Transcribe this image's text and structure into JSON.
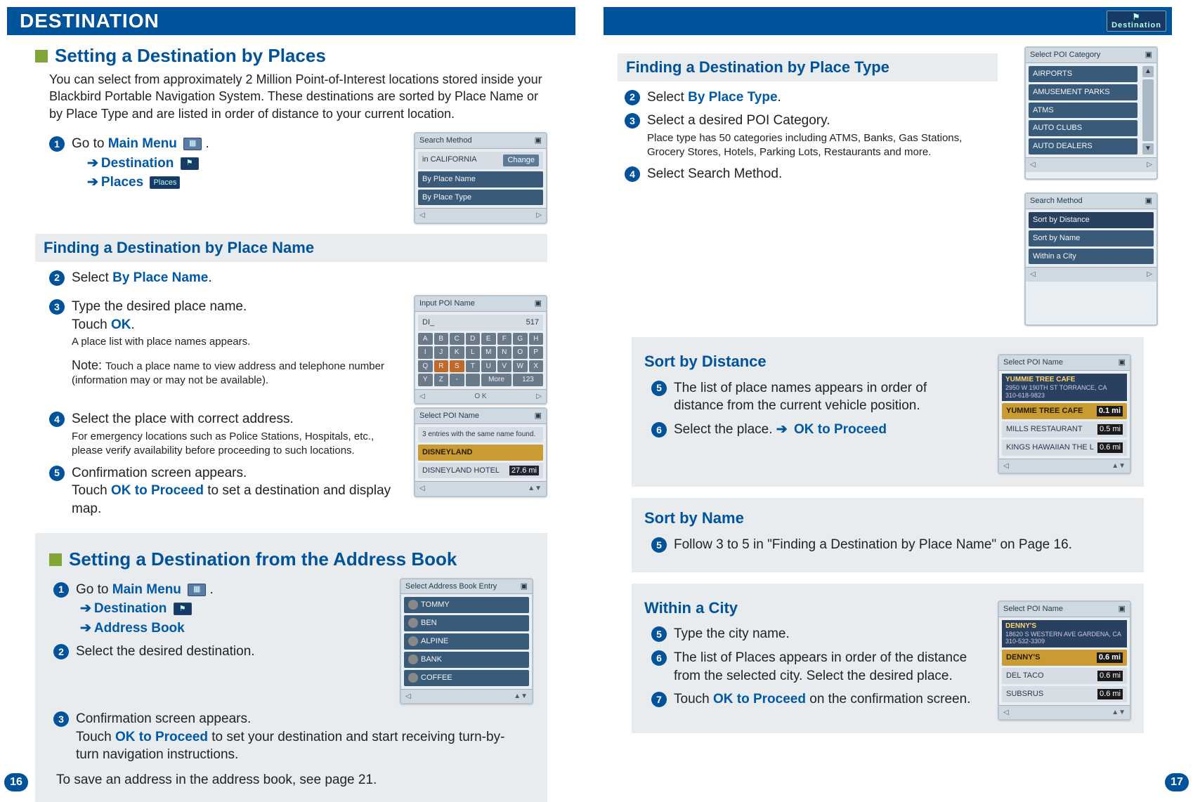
{
  "left": {
    "header": "DESTINATION",
    "section1_title": "Setting a Destination by Places",
    "intro": "You can select from approximately 2 Million Point-of-Interest locations stored inside your Blackbird Portable Navigation System.  These destinations are sorted by Place Name or by Place Type and are listed in order of distance to your current location.",
    "step1_pre": "Go to ",
    "step1_link": "Main Menu",
    "step1_post": " .",
    "step1_a_label": "Destination",
    "step1_b_label": "Places",
    "sub_name": "Finding a Destination by Place Name",
    "step2_pre": "Select ",
    "step2_link": "By Place Name",
    "step2_post": ".",
    "step3_l1": "Type the desired place name.",
    "step3_l2a": "Touch ",
    "step3_l2b": "OK",
    "step3_l2c": ".",
    "step3_sub": "A place list with place names appears.",
    "step3_note_lbl": "Note: ",
    "step3_note": "Touch a place name to view address and telephone number (information may or may not be available).",
    "step4_l1": "Select the place with correct address.",
    "step4_sub": "For emergency locations such as Police Stations, Hospitals, etc., please verify availability before proceeding to such locations.",
    "step5_l1": "Confirmation screen appears.",
    "step5_l2a": "Touch ",
    "step5_l2b": "OK to Proceed",
    "step5_l2c": " to set a destination and display map.",
    "section2_title": "Setting a Destination from the Address Book",
    "ab_step1_pre": "Go to ",
    "ab_step1_link": "Main Menu",
    "ab_step1_post": " .",
    "ab_step1_a": "Destination",
    "ab_step1_b": "Address Book",
    "ab_step2": "Select the desired destination.",
    "ab_step3_l1": "Confirmation screen appears.",
    "ab_step3_l2a": "Touch ",
    "ab_step3_l2b": "OK to Proceed",
    "ab_step3_l2c": " to set your destination and start receiving turn-by-turn navigation instructions.",
    "ab_foot": "To save an address in the address book, see page 21.",
    "ss1_title": "Search Method",
    "ss1_pill": "in CALIFORNIA",
    "ss1_change": "Change",
    "ss1_row1": "By Place Name",
    "ss1_row2": "By Place Type",
    "ss2_title": "Input POI Name",
    "ss2_value": "DI_",
    "ss2_count": "517",
    "ss2_keys": [
      "A",
      "B",
      "C",
      "D",
      "E",
      "F",
      "G",
      "H",
      "I",
      "J",
      "K",
      "L",
      "M",
      "N",
      "O",
      "P",
      "Q",
      "R",
      "S",
      "T",
      "U",
      "V",
      "W",
      "X",
      "Y",
      "Z",
      "-",
      "",
      "More",
      "123"
    ],
    "ss2_ok": "O K",
    "ss3_title": "Select POI Name",
    "ss3_msg": "3 entries with the same name found.",
    "ss3_row1": "DISNEYLAND",
    "ss3_row2": "DISNEYLAND HOTEL",
    "ss3_dist": "27.6 mi",
    "ss4_title": "Select Address Book Entry",
    "ss4_items": [
      "TOMMY",
      "BEN",
      "ALPINE",
      "BANK",
      "COFFEE"
    ]
  },
  "right": {
    "badge": "Destination",
    "sub_type": "Finding a Destination by Place Type",
    "step2_pre": "Select ",
    "step2_link": "By Place Type",
    "step2_post": ".",
    "step3_l1": "Select a desired POI Category.",
    "step3_sub": "Place type has 50 categories including ATMS, Banks, Gas Stations, Grocery Stores, Hotels, Parking Lots, Restaurants and more.",
    "step4": "Select Search Method.",
    "ss5_title": "Select POI Category",
    "ss5_items": [
      "AIRPORTS",
      "AMUSEMENT PARKS",
      "ATMS",
      "AUTO CLUBS",
      "AUTO DEALERS"
    ],
    "ss6_title": "Search Method",
    "ss6_items": [
      "Sort by Distance",
      "Sort by Name",
      "Within a City"
    ],
    "sd_head": "Sort by Distance",
    "sd_step5": "The list of place names appears in order of distance from the current vehicle position.",
    "sd_step6_pre": "Select the place. ",
    "sd_step6_arrow": "➔",
    "sd_step6_link": "OK to Proceed",
    "ss7_title": "Select POI Name",
    "ss7_top_name": "YUMMIE TREE CAFE",
    "ss7_top_addr": "2950 W 190TH ST TORRANCE, CA",
    "ss7_top_phone": "310-618-9823",
    "ss7_items": [
      {
        "n": "YUMMIE TREE CAFE",
        "d": "0.1 mi"
      },
      {
        "n": "MILLS RESTAURANT",
        "d": "0.5 mi"
      },
      {
        "n": "KINGS HAWAIIAN THE L",
        "d": "0.6 mi"
      }
    ],
    "sn_head": "Sort by Name",
    "sn_step5": "Follow 3 to 5 in \"Finding a Destination by Place Name\" on Page 16.",
    "wc_head": "Within a City",
    "wc_step5": "Type the city name.",
    "wc_step6": "The list of Places appears in order of the distance from the selected city. Select the desired place.",
    "wc_step7_pre": "Touch ",
    "wc_step7_link": "OK to Proceed",
    "wc_step7_post": " on the confirmation screen.",
    "ss8_title": "Select POI Name",
    "ss8_top_name": "DENNY'S",
    "ss8_top_addr": "18620 S WESTERN AVE GARDENA, CA",
    "ss8_top_phone": "310-532-3309",
    "ss8_items": [
      {
        "n": "DENNY'S",
        "d": "0.6 mi"
      },
      {
        "n": "DEL TACO",
        "d": "0.6 mi"
      },
      {
        "n": "SUBSRUS",
        "d": "0.6 mi"
      }
    ]
  },
  "page_left": "16",
  "page_right": "17"
}
